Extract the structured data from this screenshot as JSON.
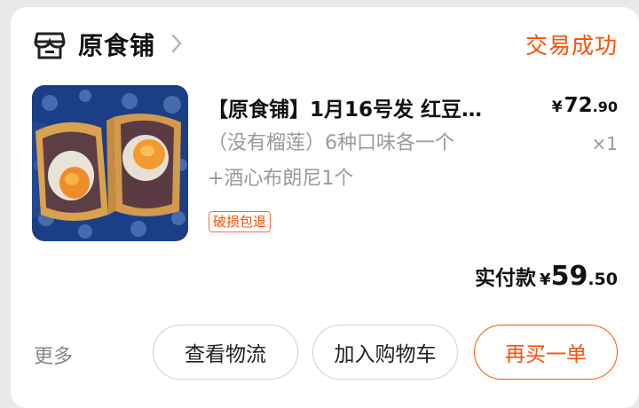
{
  "shop": {
    "name": "原食铺",
    "icon": "shop-icon"
  },
  "order": {
    "status": "交易成功",
    "status_color": "#ff5000"
  },
  "product": {
    "title": "【原食铺】1月16号发 红豆…",
    "sku_line1": "（没有榴莲）6种口味各一个",
    "sku_line2": "+酒心布朗尼1个",
    "price_symbol": "¥",
    "price_int": "72",
    "price_dec": ".90",
    "quantity": "×1",
    "tag": "破损包退",
    "image": "mooncake-photo"
  },
  "payment": {
    "label": "实付款",
    "symbol": "¥",
    "int": "59",
    "dec": ".50"
  },
  "actions": {
    "more": "更多",
    "view_logistics": "查看物流",
    "add_to_cart": "加入购物车",
    "buy_again": "再买一单"
  }
}
